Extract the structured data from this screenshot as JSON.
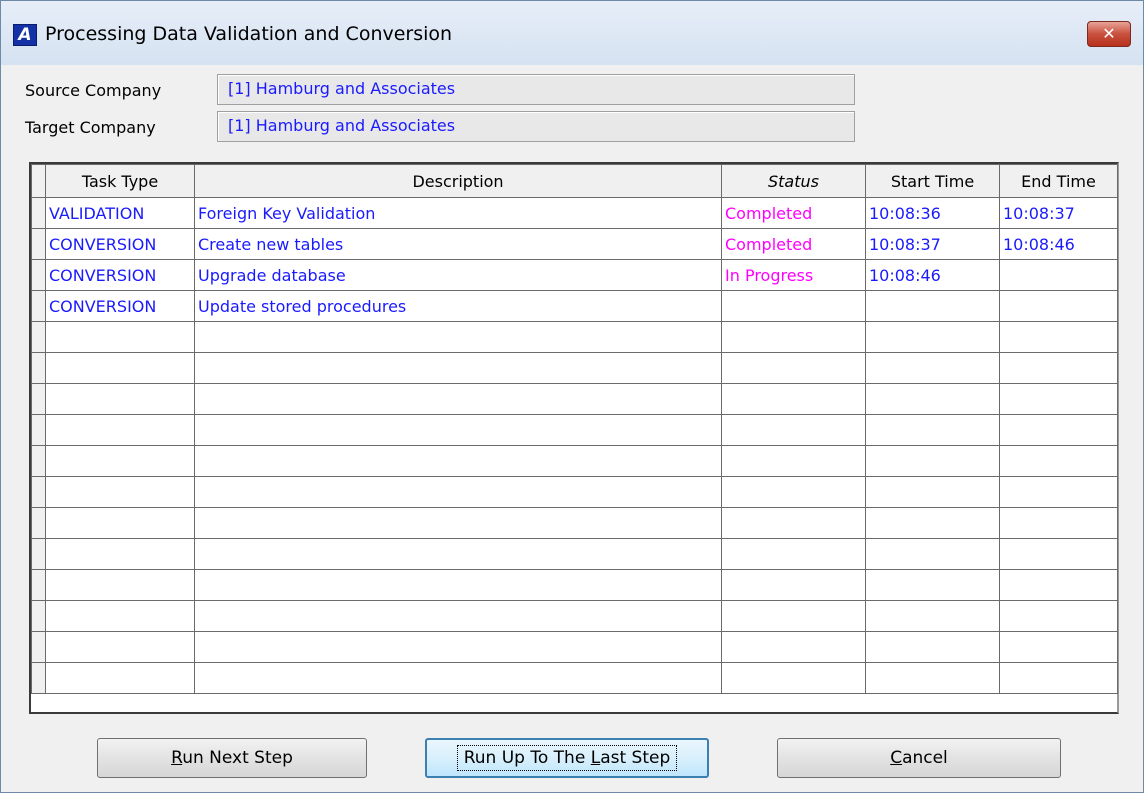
{
  "window": {
    "title": "Processing Data Validation and Conversion",
    "app_icon_glyph": "A",
    "close_glyph": "✕"
  },
  "fields": {
    "source_label": "Source Company",
    "source_value": "[1] Hamburg and Associates",
    "target_label": "Target Company",
    "target_value": "[1] Hamburg and Associates"
  },
  "grid": {
    "columns": [
      "Task Type",
      "Description",
      "Status",
      "Start Time",
      "End Time"
    ],
    "rows": [
      {
        "task_type": "VALIDATION",
        "description": "Foreign Key Validation",
        "status": "Completed",
        "start_time": "10:08:36",
        "end_time": "10:08:37"
      },
      {
        "task_type": "CONVERSION",
        "description": "Create new tables",
        "status": "Completed",
        "start_time": "10:08:37",
        "end_time": "10:08:46"
      },
      {
        "task_type": "CONVERSION",
        "description": "Upgrade database",
        "status": "In Progress",
        "start_time": "10:08:46",
        "end_time": ""
      },
      {
        "task_type": "CONVERSION",
        "description": "Update stored procedures",
        "status": "",
        "start_time": "",
        "end_time": ""
      }
    ],
    "empty_row_count": 12
  },
  "buttons": {
    "run_next_prefix": "R",
    "run_next_rest": "un Next Step",
    "run_last_prefix": "Run Up To The ",
    "run_last_mnemonic": "L",
    "run_last_rest": "ast Step",
    "cancel_prefix": "C",
    "cancel_rest": "ancel"
  },
  "colors": {
    "value_text": "#1a1aff",
    "status_text": "#ff00ff",
    "close_button": "#c9503e"
  }
}
